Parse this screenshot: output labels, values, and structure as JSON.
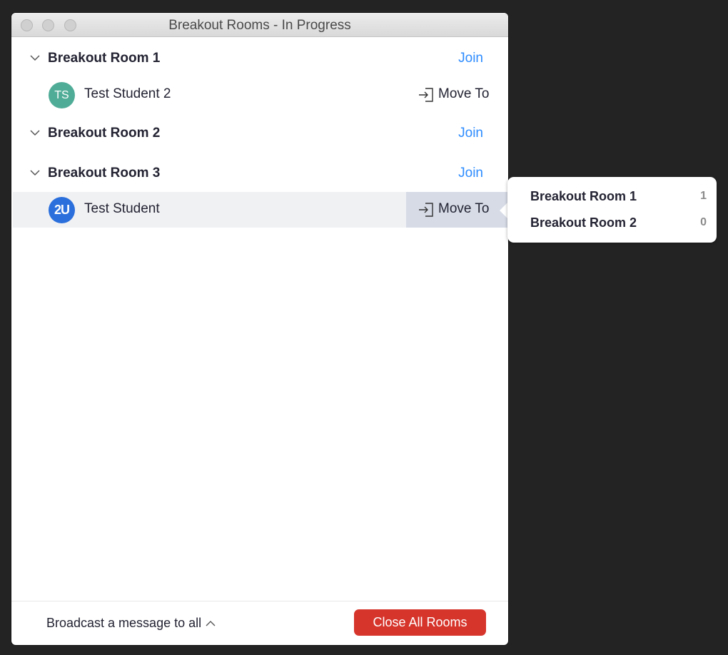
{
  "window": {
    "title": "Breakout Rooms - In Progress"
  },
  "rooms": [
    {
      "name": "Breakout Room 1",
      "join_label": "Join",
      "participants": [
        {
          "initials": "TS",
          "name": "Test Student 2",
          "move_label": "Move To",
          "avatar_color": "#4fac97"
        }
      ]
    },
    {
      "name": "Breakout Room 2",
      "join_label": "Join",
      "participants": []
    },
    {
      "name": "Breakout Room 3",
      "join_label": "Join",
      "participants": [
        {
          "initials": "2U",
          "name": "Test Student",
          "move_label": "Move To",
          "avatar_color": "#2a6fdc"
        }
      ]
    }
  ],
  "move_menu": [
    {
      "name": "Breakout Room 1",
      "count": "1"
    },
    {
      "name": "Breakout Room 2",
      "count": "0"
    }
  ],
  "footer": {
    "broadcast_label": "Broadcast a message to all",
    "close_label": "Close All Rooms"
  },
  "colors": {
    "accent": "#2d8cff",
    "danger": "#d6352c"
  }
}
